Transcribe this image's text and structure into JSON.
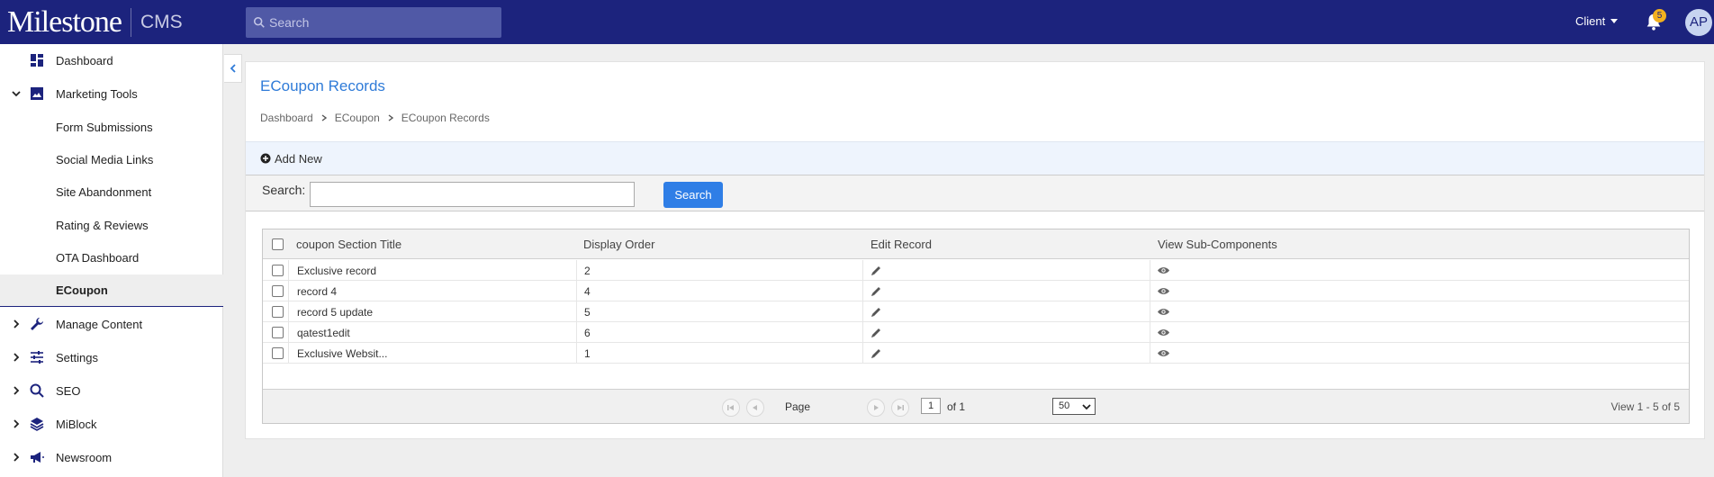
{
  "app": {
    "logo_text": "Milestone",
    "product": "CMS",
    "search_placeholder": "Search",
    "client_label": "Client",
    "notification_count": "5",
    "avatar_initials": "AP"
  },
  "sidebar": {
    "items": [
      {
        "label": "Dashboard",
        "icon": "dashboard-icon"
      },
      {
        "label": "Marketing Tools",
        "icon": "image-icon"
      },
      {
        "label": "Form Submissions"
      },
      {
        "label": "Social Media Links"
      },
      {
        "label": "Site Abandonment"
      },
      {
        "label": "Rating & Reviews"
      },
      {
        "label": "OTA Dashboard"
      },
      {
        "label": "ECoupon"
      },
      {
        "label": "Manage Content",
        "icon": "wrench-icon"
      },
      {
        "label": "Settings",
        "icon": "sliders-icon"
      },
      {
        "label": "SEO",
        "icon": "search-icon"
      },
      {
        "label": "MiBlock",
        "icon": "layers-icon"
      },
      {
        "label": "Newsroom",
        "icon": "megaphone-icon"
      }
    ]
  },
  "page": {
    "title": "ECoupon Records",
    "breadcrumb": [
      "Dashboard",
      "ECoupon",
      "ECoupon Records"
    ],
    "add_new": "Add New",
    "search_label": "Search:",
    "search_value": "",
    "search_button": "Search"
  },
  "grid": {
    "columns": [
      "coupon Section Title",
      "Display Order",
      "Edit Record",
      "View Sub-Components"
    ],
    "rows": [
      {
        "title": "Exclusive record",
        "order": "2"
      },
      {
        "title": "record 4",
        "order": "4"
      },
      {
        "title": "record 5 update",
        "order": "5"
      },
      {
        "title": "qatest1edit",
        "order": "6"
      },
      {
        "title": "Exclusive Websit...",
        "order": "1"
      }
    ],
    "pager": {
      "page_label": "Page",
      "page": "1",
      "of_label": "of 1",
      "page_size": "50",
      "view_text": "View 1 - 5 of 5"
    }
  },
  "colors": {
    "topbar": "#1c237d",
    "accent": "#2f7bd8",
    "badge": "#f2b01e"
  }
}
